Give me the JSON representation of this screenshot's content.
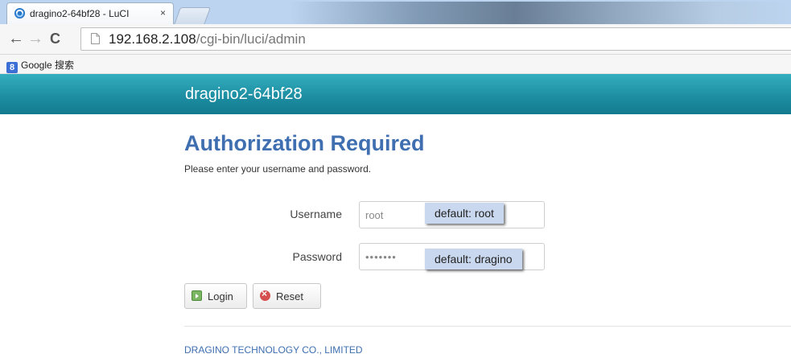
{
  "browser": {
    "tab": {
      "title": "dragino2-64bf28 - LuCI",
      "close": "×"
    },
    "nav": {
      "back": "←",
      "forward": "→",
      "reload": "C"
    },
    "address": {
      "host": "192.168.2.108",
      "path": "/cgi-bin/luci/admin"
    },
    "bookmarks": [
      {
        "icon_letter": "8",
        "label": "Google 搜索"
      }
    ]
  },
  "header": {
    "hostname": "dragino2-64bf28",
    "color": "#1e8fa3"
  },
  "login": {
    "title": "Authorization Required",
    "subtitle": "Please enter your username and password.",
    "username": {
      "label": "Username",
      "value": "root",
      "callout": "default: root"
    },
    "password": {
      "label": "Password",
      "value": "•••••••",
      "callout": "default: dragino"
    },
    "buttons": {
      "login": "Login",
      "reset": "Reset"
    }
  },
  "footer": {
    "text": "DRAGINO TECHNOLOGY CO., LIMITED"
  },
  "colors": {
    "accent": "#3f6fb0",
    "callout_bg": "#c9d8ee"
  }
}
